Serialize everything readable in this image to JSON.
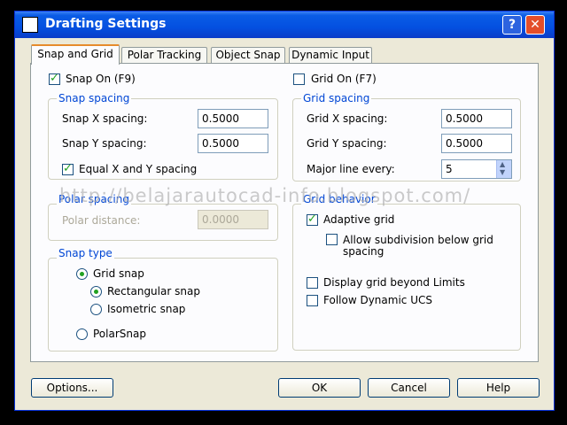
{
  "window": {
    "title": "Drafting Settings",
    "help_btn": "?",
    "close_btn": "✕"
  },
  "tabs": [
    {
      "label": "Snap and Grid"
    },
    {
      "label": "Polar Tracking"
    },
    {
      "label": "Object Snap"
    },
    {
      "label": "Dynamic Input"
    }
  ],
  "snap": {
    "snap_on": "Snap On (F9)",
    "spacing_group": "Snap spacing",
    "x_label": "Snap X spacing:",
    "x_value": "0.5000",
    "y_label": "Snap Y spacing:",
    "y_value": "0.5000",
    "equal_label": "Equal X and Y spacing"
  },
  "polar": {
    "group": "Polar spacing",
    "distance_label": "Polar distance:",
    "distance_value": "0.0000"
  },
  "snap_type": {
    "group": "Snap type",
    "grid_snap": "Grid snap",
    "rectangular": "Rectangular snap",
    "isometric": "Isometric snap",
    "polarsnap": "PolarSnap"
  },
  "grid": {
    "grid_on": "Grid On (F7)",
    "spacing_group": "Grid spacing",
    "x_label": "Grid X spacing:",
    "x_value": "0.5000",
    "y_label": "Grid Y spacing:",
    "y_value": "0.5000",
    "major_label": "Major line every:",
    "major_value": "5"
  },
  "grid_behavior": {
    "group": "Grid behavior",
    "adaptive": "Adaptive grid",
    "subdivision_line1": "Allow subdivision below grid",
    "subdivision_line2": "spacing",
    "beyond_limits": "Display grid beyond Limits",
    "follow_ucs": "Follow Dynamic UCS"
  },
  "buttons": {
    "options": "Options...",
    "ok": "OK",
    "cancel": "Cancel",
    "help": "Help"
  },
  "watermark": "http://belajarautocad-info.blogspot.com/"
}
